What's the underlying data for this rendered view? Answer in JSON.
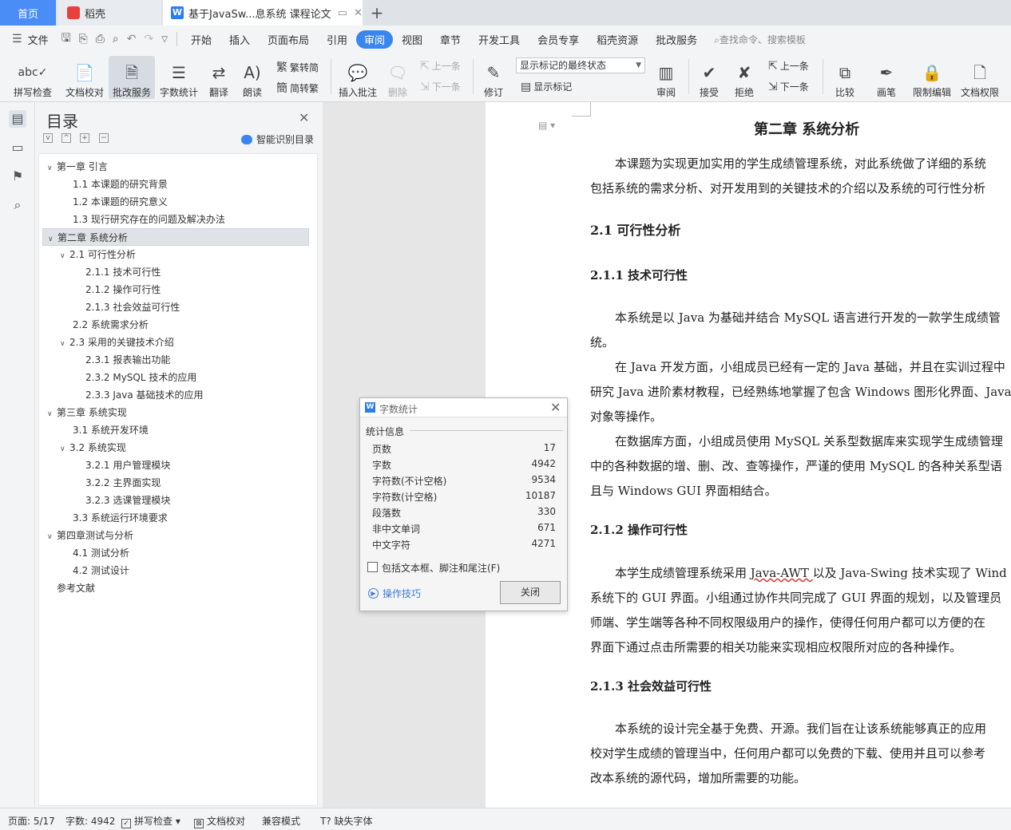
{
  "tabs": {
    "home": "首页",
    "daoke": "稻壳",
    "doc": "基于JavaSw...息系统 课程论文",
    "new_tab": "+"
  },
  "menu": {
    "file": "文件",
    "items": [
      "开始",
      "插入",
      "页面布局",
      "引用",
      "审阅",
      "视图",
      "章节",
      "开发工具",
      "会员专享",
      "稻壳资源",
      "批改服务"
    ],
    "active": "审阅",
    "search_placeholder": "查找命令、搜索模板"
  },
  "ribbon": {
    "spell_check": "拼写检查",
    "doc_proof": "文档校对",
    "review_service": "批改服务",
    "word_count": "字数统计",
    "translate": "翻译",
    "read_aloud": "朗读",
    "trad_to_simp": "繁转简",
    "simp_to_trad": "简转繁",
    "insert_comment": "插入批注",
    "delete": "删除",
    "prev_comment": "上一条",
    "next_comment": "下一条",
    "track_changes": "修订",
    "markup_state": "显示标记的最终状态",
    "show_markup": "显示标记",
    "review": "审阅",
    "accept": "接受",
    "reject": "拒绝",
    "prev_change": "上一条",
    "next_change": "下一条",
    "compare": "比较",
    "pen": "画笔",
    "restrict_edit": "限制编辑",
    "doc_permission": "文档权限"
  },
  "toc": {
    "title": "目录",
    "smart_recognize": "智能识别目录",
    "items": [
      {
        "label": "第一章  引言",
        "level": 0,
        "toggle": "v"
      },
      {
        "label": "1.1  本课题的研究背景",
        "level": 1,
        "toggle": ""
      },
      {
        "label": "1.2  本课题的研究意义",
        "level": 1,
        "toggle": ""
      },
      {
        "label": "1.3  现行研究存在的问题及解决办法",
        "level": 1,
        "toggle": ""
      },
      {
        "label": "第二章    系统分析",
        "level": 0,
        "toggle": "v"
      },
      {
        "label": "2.1  可行性分析",
        "level": 1,
        "toggle": "v"
      },
      {
        "label": "2.1.1  技术可行性",
        "level": 2,
        "toggle": ""
      },
      {
        "label": "2.1.2  操作可行性",
        "level": 2,
        "toggle": ""
      },
      {
        "label": "2.1.3  社会效益可行性",
        "level": 2,
        "toggle": ""
      },
      {
        "label": "2.2 系统需求分析",
        "level": 1,
        "toggle": ""
      },
      {
        "label": "2.3  采用的关键技术介绍",
        "level": 1,
        "toggle": "v"
      },
      {
        "label": "2.3.1 报表输出功能",
        "level": 2,
        "toggle": ""
      },
      {
        "label": "2.3.2 MySQL 技术的应用",
        "level": 2,
        "toggle": ""
      },
      {
        "label": "2.3.3 Java 基础技术的应用",
        "level": 2,
        "toggle": ""
      },
      {
        "label": "第三章  系统实现",
        "level": 0,
        "toggle": "v"
      },
      {
        "label": "3.1  系统开发环境",
        "level": 1,
        "toggle": ""
      },
      {
        "label": "3.2  系统实现",
        "level": 1,
        "toggle": "v"
      },
      {
        "label": "3.2.1 用户管理模块",
        "level": 2,
        "toggle": ""
      },
      {
        "label": "3.2.2 主界面实现",
        "level": 2,
        "toggle": ""
      },
      {
        "label": "3.2.3 选课管理模块",
        "level": 2,
        "toggle": ""
      },
      {
        "label": "3.3  系统运行环境要求",
        "level": 1,
        "toggle": ""
      },
      {
        "label": "第四章测试与分析",
        "level": 0,
        "toggle": "v"
      },
      {
        "label": "4.1 测试分析",
        "level": 1,
        "toggle": ""
      },
      {
        "label": "4.2 测试设计",
        "level": 1,
        "toggle": ""
      },
      {
        "label": "参考文献",
        "level": 0,
        "toggle": ""
      }
    ],
    "selected_index": 4
  },
  "document": {
    "chapter_title": "第二章    系统分析",
    "p1_l1": "本课题为实现更加实用的学生成绩管理系统，对此系统做了详细的系统",
    "p1_l2": "包括系统的需求分析、对开发用到的关键技术的介绍以及系统的可行性分析",
    "h_2_1": "2.1  可行性分析",
    "h_2_1_1": "2.1.1  技术可行性",
    "p2_l1": "本系统是以 Java 为基础并结合 MySQL 语言进行开发的一款学生成绩管",
    "p2_l2": "统。",
    "p3_l1": "在 Java 开发方面，小组成员已经有一定的 Java 基础，并且在实训过程中",
    "p3_l2": "研究 Java 进阶素材教程，已经熟练地掌握了包含 Windows 图形化界面、Java",
    "p3_l3": "对象等操作。",
    "p4_l1": "在数据库方面，小组成员使用 MySQL 关系型数据库来实现学生成绩管理",
    "p4_l2": "中的各种数据的增、删、改、查等操作，严谨的使用 MySQL 的各种关系型语",
    "p4_l3": "且与 Windows GUI 界面相结合。",
    "h_2_1_2": "2.1.2  操作可行性",
    "p5_l1a": "本学生成绩管理系统采用 ",
    "p5_l1b": "Java-AWT ",
    "p5_l1c": "以及 Java-Swing 技术实现了 Wind",
    "p5_l2": "系统下的 GUI 界面。小组通过协作共同完成了 GUI 界面的规划，以及管理员",
    "p5_l3": "师端、学生端等各种不同权限级用户的操作，使得任何用户都可以方便的在",
    "p5_l4": "界面下通过点击所需要的相关功能来实现相应权限所对应的各种操作。",
    "h_2_1_3": "2.1.3  社会效益可行性",
    "p6_l1": "本系统的设计完全基于免费、开源。我们旨在让该系统能够真正的应用",
    "p6_l2": "校对学生成绩的管理当中，任何用户都可以免费的下载、使用并且可以参考",
    "p6_l3": "改本系统的源代码，增加所需要的功能。"
  },
  "dialog": {
    "title": "字数统计",
    "group_label": "统计信息",
    "stats": [
      {
        "label": "页数",
        "value": "17"
      },
      {
        "label": "字数",
        "value": "4942"
      },
      {
        "label": "字符数(不计空格)",
        "value": "9534"
      },
      {
        "label": "字符数(计空格)",
        "value": "10187"
      },
      {
        "label": "段落数",
        "value": "330"
      },
      {
        "label": "非中文单词",
        "value": "671"
      },
      {
        "label": "中文字符",
        "value": "4271"
      }
    ],
    "checkbox_label": "包括文本框、脚注和尾注(F)",
    "tips": "操作技巧",
    "close_button": "关闭"
  },
  "status": {
    "page": "页面: 5/17",
    "words": "字数: 4942",
    "spell_check": "拼写检查",
    "doc_proof": "文档校对",
    "compat_mode": "兼容模式",
    "missing_font": "缺失字体"
  },
  "colors": {
    "accent": "#3a86f0",
    "tab_home": "#4a8df6",
    "logo_red": "#e8413c"
  }
}
